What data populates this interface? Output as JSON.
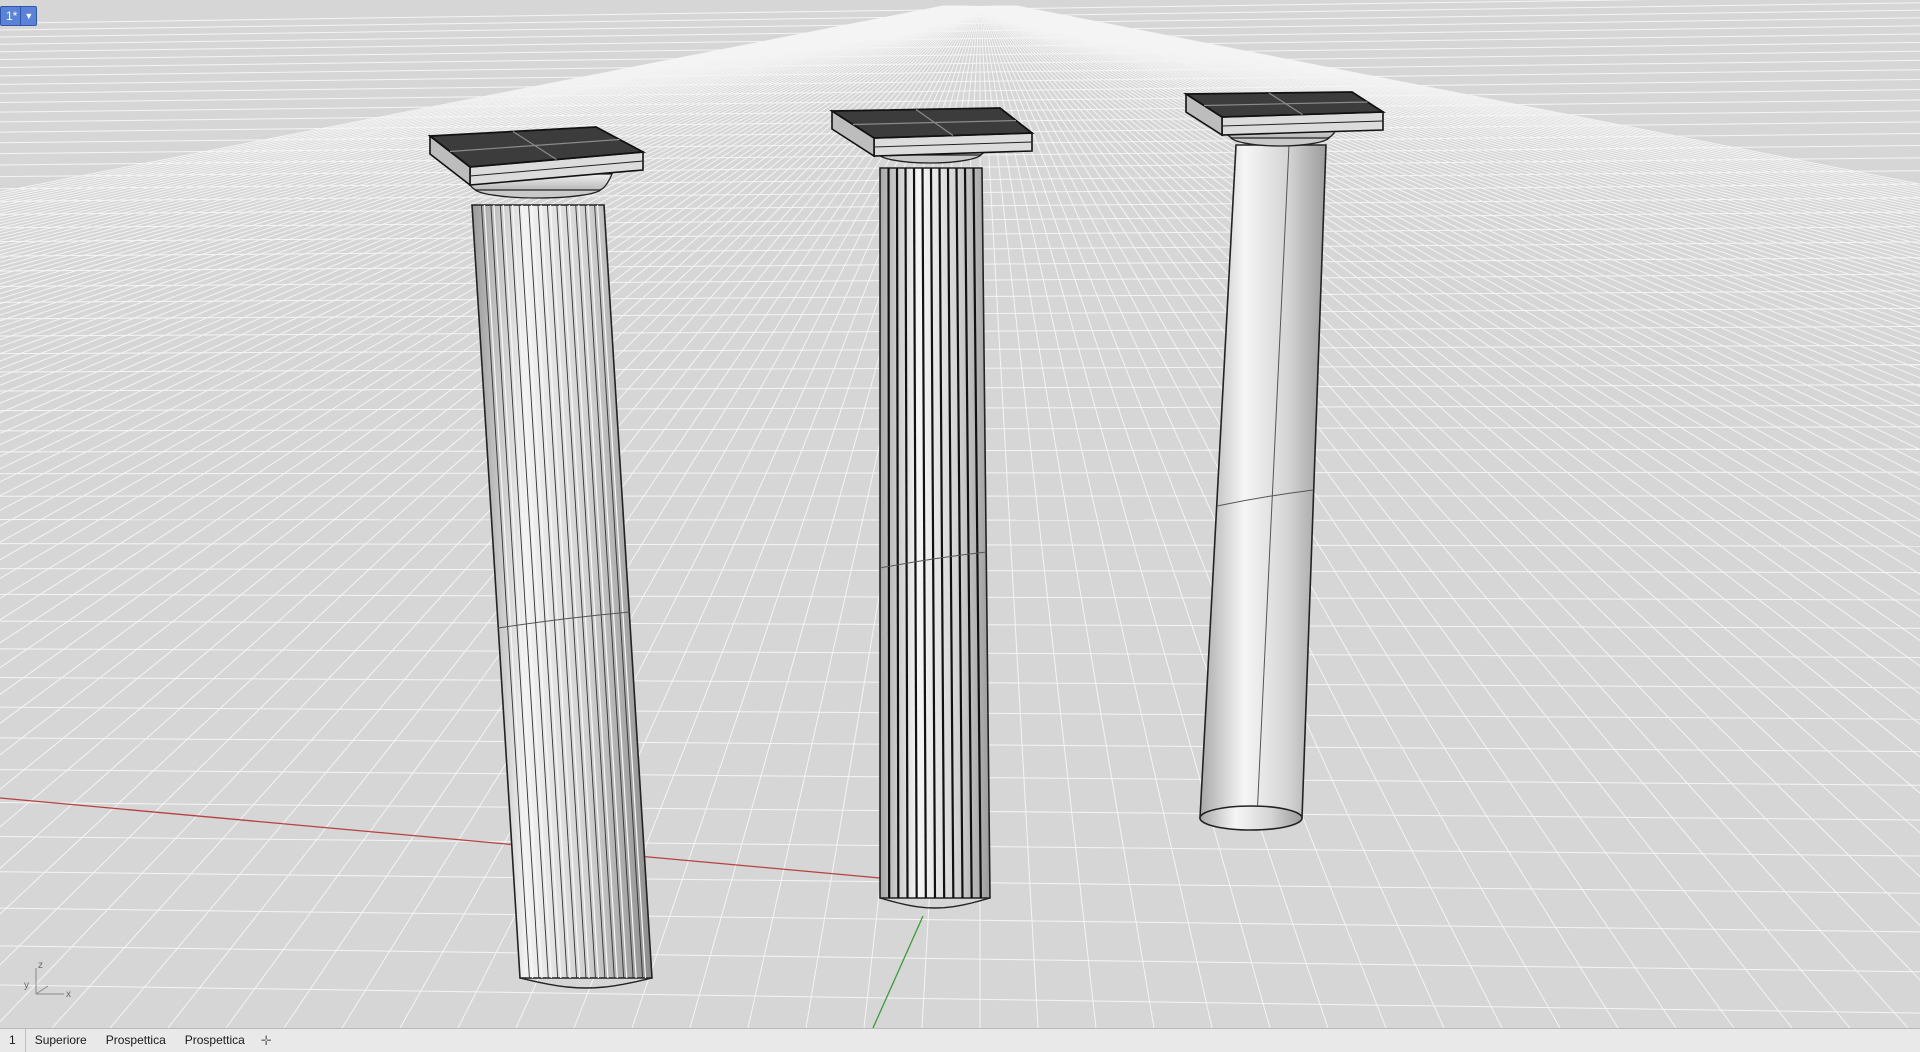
{
  "viewport": {
    "label": "1*",
    "dropdown_icon": "triangle-down",
    "background": "#d6d6d6",
    "grid_color": "#f4f4f4",
    "x_axis_color": "#b84040",
    "y_axis_color": "#3a9a3a",
    "objects": [
      {
        "name": "column-fluted-left",
        "display": "shaded"
      },
      {
        "name": "column-fluted-center",
        "display": "wireframe-shaded"
      },
      {
        "name": "column-plain-right",
        "display": "shaded"
      }
    ]
  },
  "axis_icon": {
    "x": "x",
    "y": "y",
    "z": "z"
  },
  "tabbar": {
    "tabs": [
      "1",
      "Superiore",
      "Prospettica",
      "Prospettica"
    ],
    "add_icon": "plus-icon"
  }
}
